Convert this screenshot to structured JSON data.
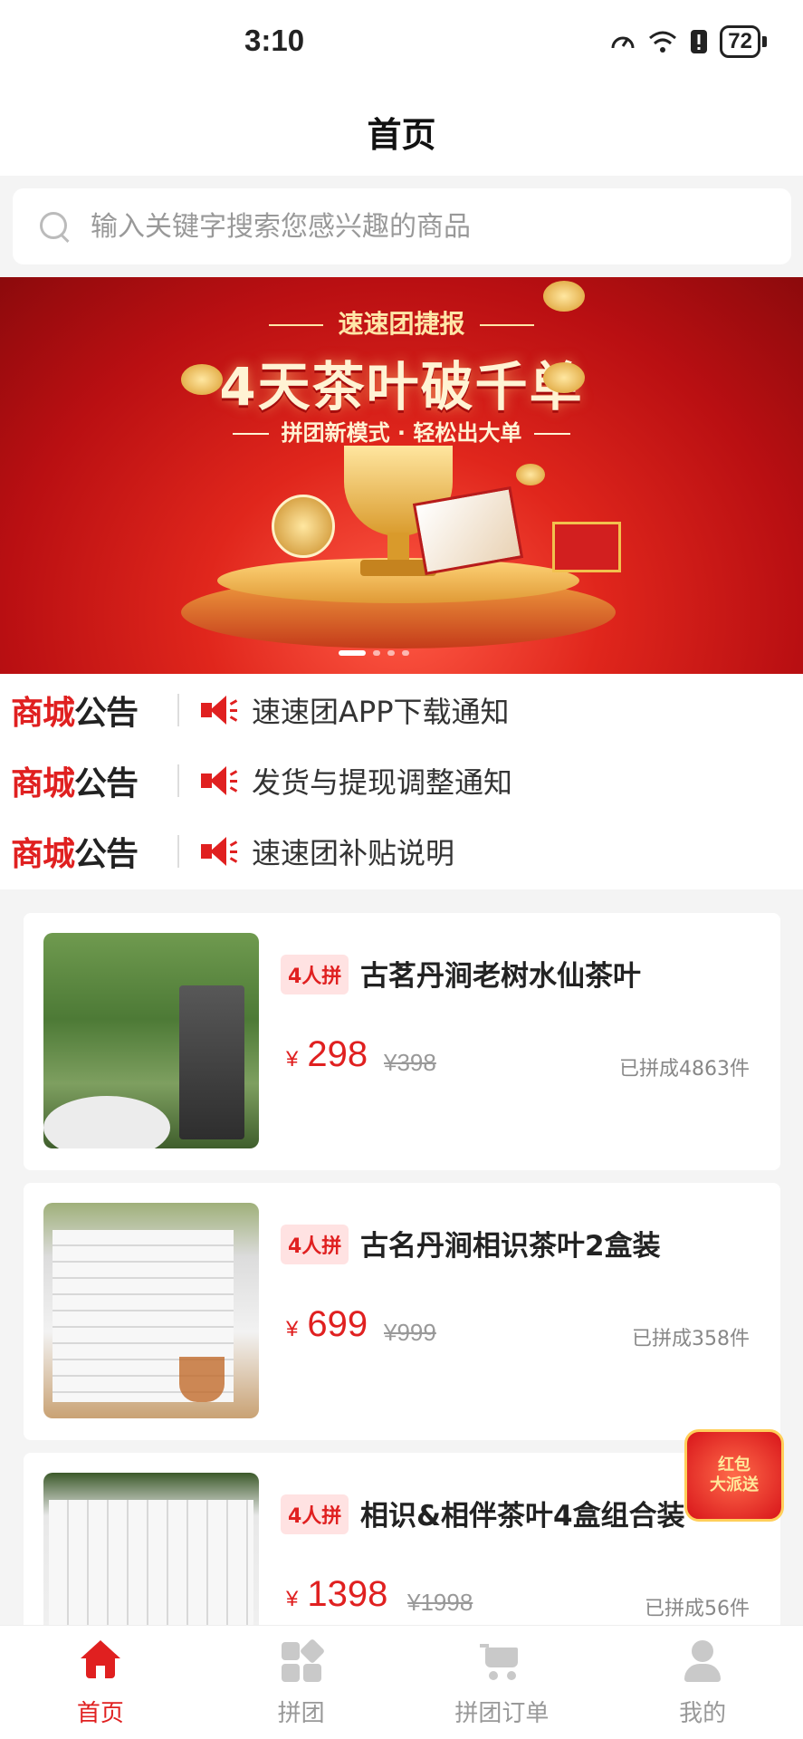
{
  "status_bar": {
    "time": "3:10",
    "battery": "72"
  },
  "header": {
    "title": "首页"
  },
  "search": {
    "placeholder": "输入关键字搜索您感兴趣的商品"
  },
  "banner": {
    "top_text": "速速团捷报",
    "headline": "4天茶叶破千单",
    "subtext": "拼团新模式 · 轻松出大单"
  },
  "notices": {
    "brand_red": "商城",
    "brand_black": "公告",
    "items": [
      {
        "text": "速速团APP下载通知"
      },
      {
        "text": "发货与提现调整通知"
      },
      {
        "text": "速速团补贴说明"
      }
    ]
  },
  "products": [
    {
      "badge": "4人拼",
      "title": "古茗丹涧老树水仙茶叶",
      "currency": "¥",
      "price": "298",
      "original_price": "¥398",
      "sold": "已拼成4863件"
    },
    {
      "badge": "4人拼",
      "title": "古名丹涧相识茶叶2盒装",
      "currency": "¥",
      "price": "699",
      "original_price": "¥999",
      "sold": "已拼成358件"
    },
    {
      "badge": "4人拼",
      "title": "相识&相伴茶叶4盒组合装",
      "currency": "¥",
      "price": "1398",
      "original_price": "¥1998",
      "sold": "已拼成56件"
    }
  ],
  "red_packet": {
    "line1": "红包",
    "line2": "大派送"
  },
  "tabbar": {
    "items": [
      {
        "label": "首页",
        "icon": "home-icon",
        "active": true
      },
      {
        "label": "拼团",
        "icon": "group-icon",
        "active": false
      },
      {
        "label": "拼团订单",
        "icon": "cart-icon",
        "active": false
      },
      {
        "label": "我的",
        "icon": "user-icon",
        "active": false
      }
    ]
  },
  "colors": {
    "accent": "#e02020",
    "inactive": "#999999",
    "badge_bg": "#ffe2e2"
  }
}
